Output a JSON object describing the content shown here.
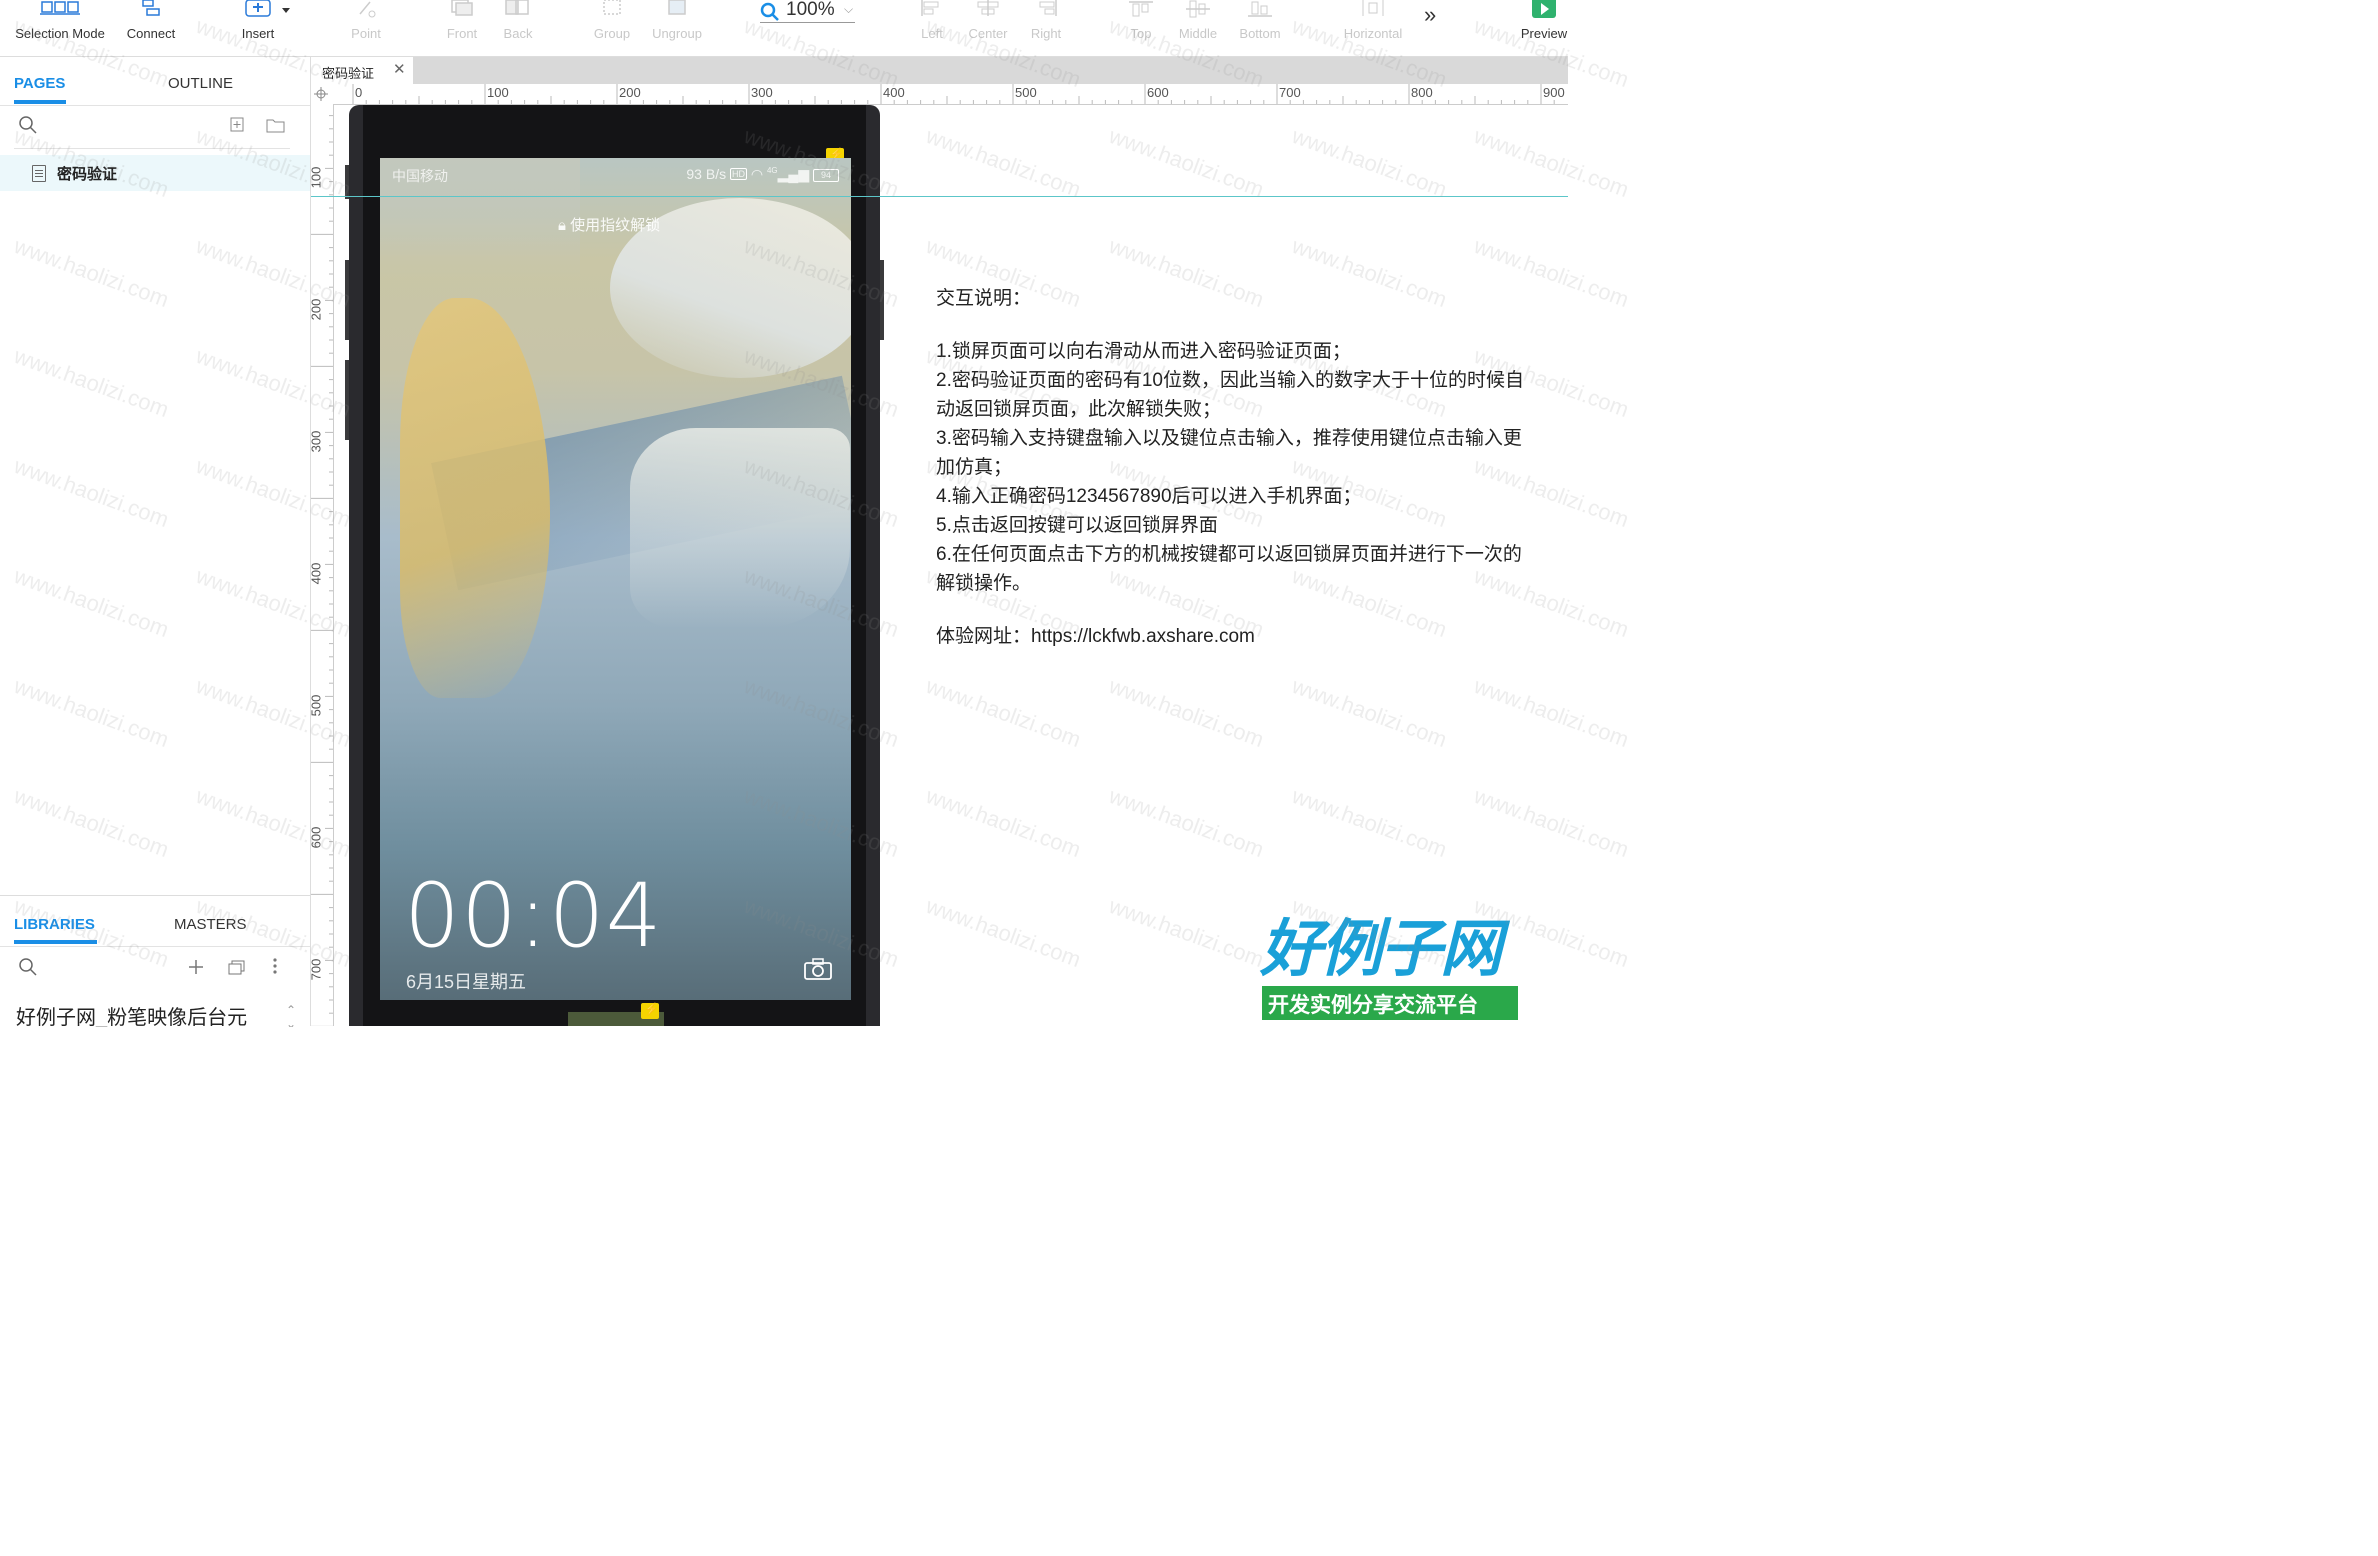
{
  "toolbar": {
    "items": [
      {
        "label": "Selection Mode",
        "icon": "selection-mode-icon",
        "enabled": true
      },
      {
        "label": "Connect",
        "icon": "connect-icon",
        "enabled": true
      },
      {
        "label": "Insert",
        "icon": "insert-icon",
        "enabled": true
      },
      {
        "label": "Point",
        "icon": "point-icon",
        "enabled": false
      },
      {
        "label": "Front",
        "icon": "front-icon",
        "enabled": false
      },
      {
        "label": "Back",
        "icon": "back-icon",
        "enabled": false
      },
      {
        "label": "Group",
        "icon": "group-icon",
        "enabled": false
      },
      {
        "label": "Ungroup",
        "icon": "ungroup-icon",
        "enabled": false
      },
      {
        "label": "Left",
        "icon": "align-left-icon",
        "enabled": false
      },
      {
        "label": "Center",
        "icon": "align-center-icon",
        "enabled": false
      },
      {
        "label": "Right",
        "icon": "align-right-icon",
        "enabled": false
      },
      {
        "label": "Top",
        "icon": "align-top-icon",
        "enabled": false
      },
      {
        "label": "Middle",
        "icon": "align-middle-icon",
        "enabled": false
      },
      {
        "label": "Bottom",
        "icon": "align-bottom-icon",
        "enabled": false
      },
      {
        "label": "Horizontal",
        "icon": "distribute-horizontal-icon",
        "enabled": false
      },
      {
        "label": "Preview",
        "icon": "preview-icon",
        "enabled": true
      }
    ],
    "zoom": "100%",
    "more_icon": "double-chevron-right-icon"
  },
  "left_panel": {
    "tabs": {
      "pages": "PAGES",
      "outline": "OUTLINE"
    },
    "pages": [
      {
        "name": "密码验证"
      }
    ],
    "library_tabs": {
      "libraries": "LIBRARIES",
      "masters": "MASTERS"
    },
    "library_selected": "好例子网_粉笔映像后台元"
  },
  "canvas": {
    "tab_title": "密码验证",
    "h_ruler": [
      "0",
      "100",
      "200",
      "300",
      "400",
      "500",
      "600",
      "700",
      "800",
      "900"
    ],
    "v_ruler": [
      "100",
      "200",
      "300",
      "400",
      "500",
      "600",
      "700"
    ],
    "watermark": "www.haolizi.com"
  },
  "phone": {
    "carrier": "中国移动",
    "net_speed": "93 B/s",
    "hd": "HD",
    "signal": "4G",
    "battery": "94",
    "lock_hint": "使用指纹解锁",
    "time": "00:04",
    "date": "6月15日星期五"
  },
  "notes": {
    "title": "交互说明：",
    "lines": [
      "1.锁屏页面可以向右滑动从而进入密码验证页面；",
      "2.密码验证页面的密码有10位数，因此当输入的数字大于十位的时候自动返回锁屏页面，此次解锁失败；",
      "3.密码输入支持键盘输入以及键位点击输入，推荐使用键位点击输入更加仿真；",
      "4.输入正确密码1234567890后可以进入手机界面；",
      "5.点击返回按键可以返回锁屏界面",
      "6.在任何页面点击下方的机械按键都可以返回锁屏页面并进行下一次的解锁操作。"
    ],
    "url": "体验网址：https://lckfwb.axshare.com"
  },
  "logo": {
    "main": "好例子网",
    "sub": "开发实例分享交流平台"
  },
  "colors": {
    "accent": "#1a8ee6",
    "guide": "#5cc6c9",
    "selected_row": "#ecf8fb",
    "logo_blue": "#1aa0d8",
    "logo_green": "#2aa84a"
  }
}
